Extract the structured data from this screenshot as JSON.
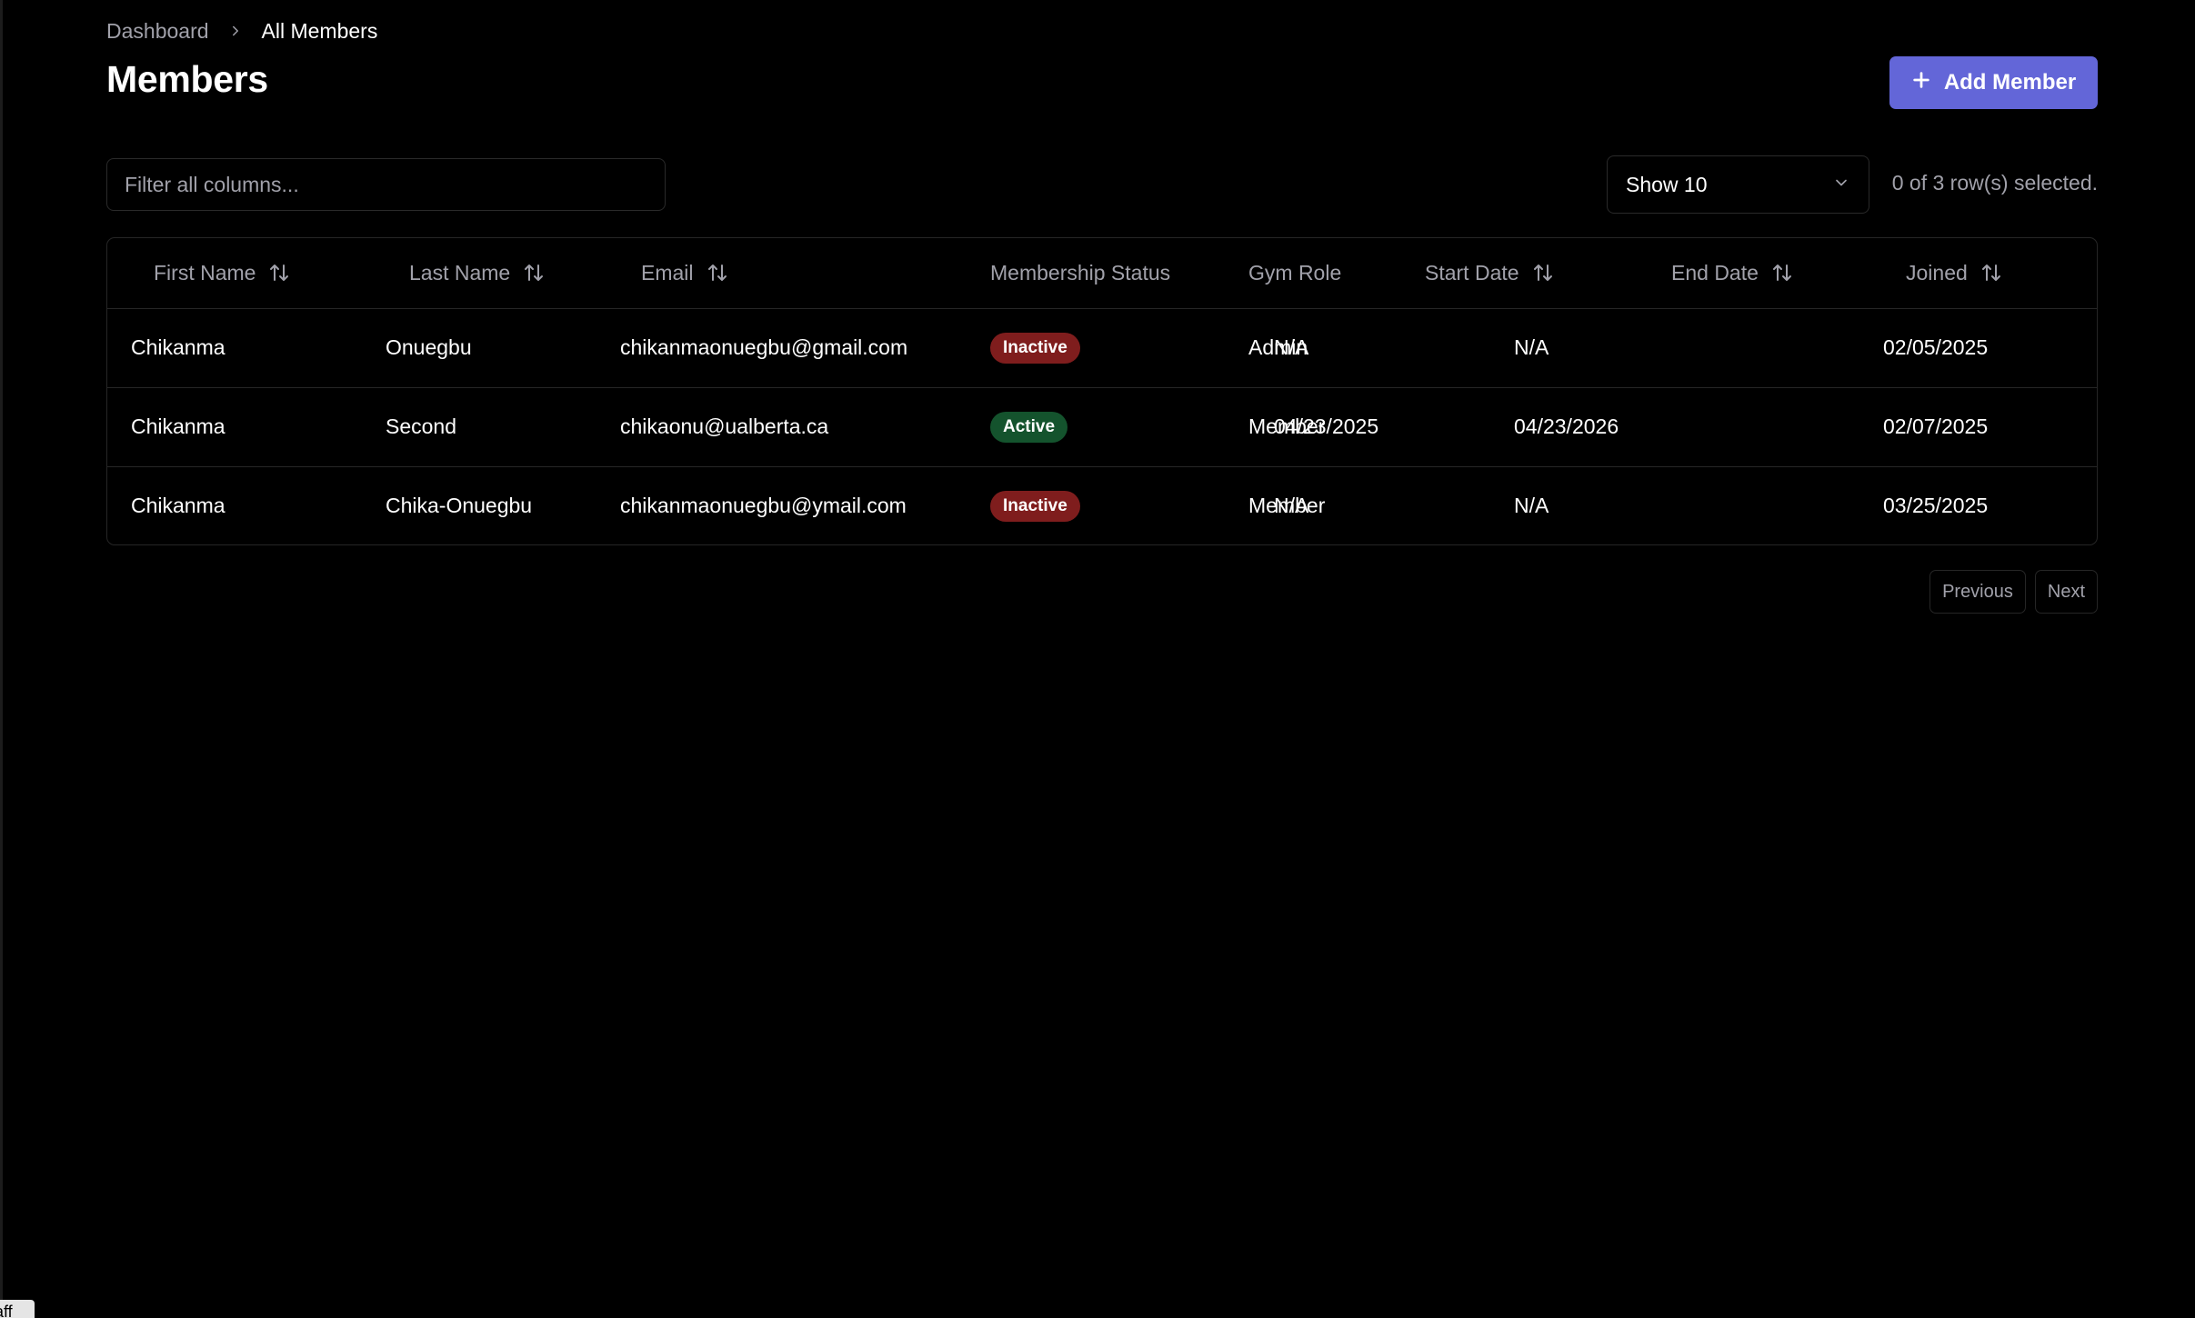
{
  "breadcrumb": {
    "parent": "Dashboard",
    "current": "All Members"
  },
  "header": {
    "title": "Members",
    "add_button_label": "Add Member"
  },
  "toolbar": {
    "filter_placeholder": "Filter all columns...",
    "filter_value": "",
    "page_size_label": "Show 10",
    "selection_text": "0 of 3 row(s) selected."
  },
  "table": {
    "columns": [
      {
        "label": "First Name",
        "sortable": true
      },
      {
        "label": "Last Name",
        "sortable": true
      },
      {
        "label": "Email",
        "sortable": true
      },
      {
        "label": "Membership Status",
        "sortable": false
      },
      {
        "label": "Gym Role",
        "sortable": false
      },
      {
        "label": "Start Date",
        "sortable": true
      },
      {
        "label": "End Date",
        "sortable": true
      },
      {
        "label": "Joined",
        "sortable": true
      }
    ],
    "rows": [
      {
        "first_name": "Chikanma",
        "last_name": "Onuegbu",
        "email": "chikanmaonuegbu@gmail.com",
        "status": "Inactive",
        "role": "Admin",
        "start_date": "N/A",
        "end_date": "N/A",
        "joined": "02/05/2025"
      },
      {
        "first_name": "Chikanma",
        "last_name": "Second",
        "email": "chikaonu@ualberta.ca",
        "status": "Active",
        "role": "Member",
        "start_date": "04/23/2025",
        "end_date": "04/23/2026",
        "joined": "02/07/2025"
      },
      {
        "first_name": "Chikanma",
        "last_name": "Chika-Onuegbu",
        "email": "chikanmaonuegbu@ymail.com",
        "status": "Inactive",
        "role": "Member",
        "start_date": "N/A",
        "end_date": "N/A",
        "joined": "03/25/2025"
      }
    ]
  },
  "pagination": {
    "previous_label": "Previous",
    "next_label": "Next"
  },
  "corner_chip": {
    "text": "aff"
  },
  "colors": {
    "background": "#000000",
    "accent": "#6366d8",
    "inactive_badge": "#7f1d1d",
    "active_badge": "#14532d",
    "muted_text": "#a1a1aa",
    "border": "#262626"
  }
}
